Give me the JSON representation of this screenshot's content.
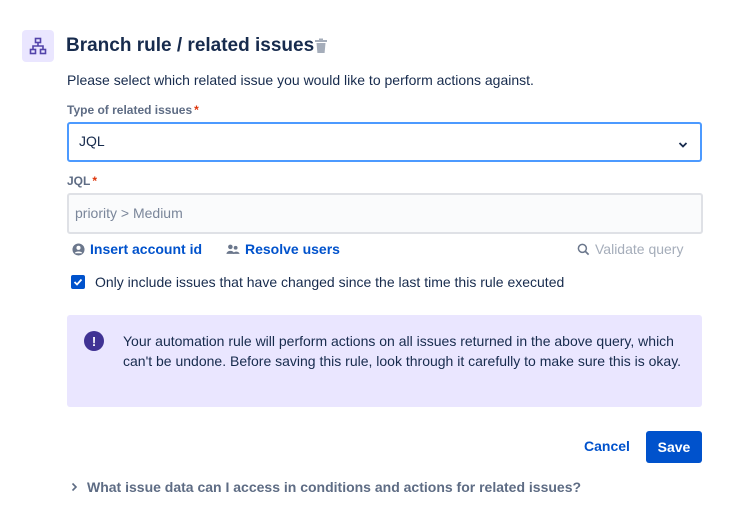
{
  "header": {
    "icon": "branch-icon",
    "title": "Branch rule / related issues",
    "delete_icon": "trash-icon"
  },
  "intro": "Please select which related issue you would like to perform actions against.",
  "type_field": {
    "label": "Type of related issues",
    "required_mark": "*",
    "value": "JQL"
  },
  "jql_field": {
    "label": "JQL",
    "required_mark": "*",
    "placeholder": "priority > Medium"
  },
  "links": {
    "insert_account_id": "Insert account id",
    "resolve_users": "Resolve users",
    "validate_query": "Validate query"
  },
  "checkbox": {
    "label": "Only include issues that have changed since the last time this rule executed",
    "checked": true
  },
  "warning": {
    "icon": "exclamation-icon",
    "text": "Your automation rule will perform actions on all issues returned in the above query, which can't be undone. Before saving this rule, look through it carefully to make sure this is okay."
  },
  "actions": {
    "cancel": "Cancel",
    "save": "Save"
  },
  "footer": {
    "text": "What issue data can I access in conditions and actions for related issues?"
  },
  "colors": {
    "primary": "#0052cc",
    "focus": "#4c9aff",
    "warning_bg": "#eae6ff",
    "warning_icon": "#403294",
    "required": "#de350b"
  }
}
